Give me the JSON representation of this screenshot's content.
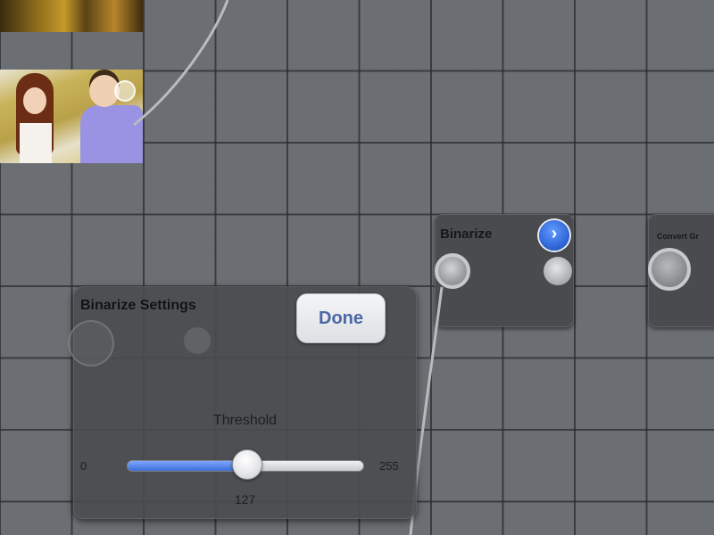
{
  "graph": {
    "nodes": [
      {
        "title": "Binarize",
        "info_icon": "chevron-right-icon"
      },
      {
        "title": "Convert Gr"
      }
    ]
  },
  "settings_panel": {
    "title": "Binarize Settings",
    "done_label": "Done",
    "slider": {
      "label": "Threshold",
      "min_label": "0",
      "max_label": "255",
      "value_label": "127",
      "min": 0,
      "max": 255,
      "value": 127
    }
  },
  "colors": {
    "canvas": "#6b6e72",
    "node": "#4a4b4f",
    "accent_blue": "#2f64d6",
    "done_text": "#4a67a3"
  }
}
